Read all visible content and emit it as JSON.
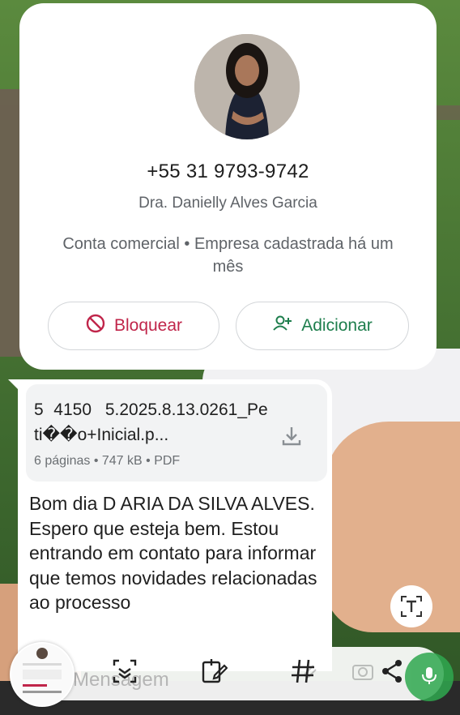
{
  "contact": {
    "phone": "+55 31 9793-9742",
    "name": "Dra. Danielly Alves Garcia",
    "business_info": "Conta comercial • Empresa cadastrada há um mês",
    "block_label": "Bloquear",
    "add_label": "Adicionar"
  },
  "message": {
    "document": {
      "name": "5   4150    5.2025.8.13.0261_Peti��o+Inicial.p...",
      "meta": "6 páginas • 747 kB • PDF"
    },
    "text": "Bom dia D                     ARIA DA SILVA ALVES. Espero que esteja bem. Estou entrando em contato para informar que temos novidades relacionadas ao processo"
  },
  "composer": {
    "placeholder": "Mensagem"
  },
  "icons": {
    "block": "block-icon",
    "add_contact": "add-contact-icon",
    "download": "download-icon",
    "text_select": "text-select-icon",
    "scan": "scan-icon",
    "edit_note": "edit-note-icon",
    "hashtag": "hashtag-icon",
    "share": "share-icon",
    "attach": "attach-icon",
    "camera": "camera-icon",
    "mic": "mic-icon"
  },
  "colors": {
    "block": "#c0254a",
    "add": "#1e7e4d",
    "mic": "#2fa84f"
  }
}
